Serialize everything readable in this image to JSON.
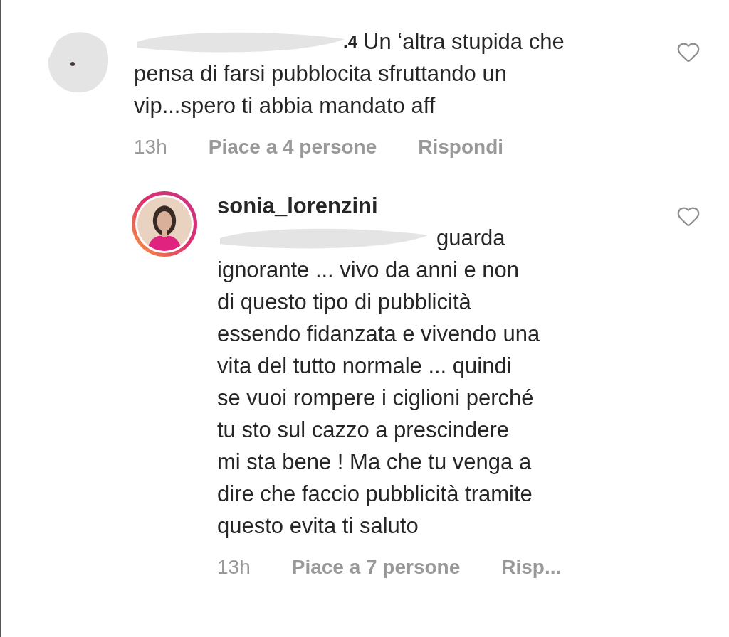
{
  "comments": [
    {
      "kind": "comment",
      "avatar_redacted": true,
      "username": ".4",
      "username_redacted": true,
      "mention_redacted": false,
      "lines": [
        "Un ‘altra stupida che",
        "pensa di farsi pubblocita sfruttando un",
        "vip...spero ti abbia mandato aff"
      ],
      "liked": false,
      "time": "13h",
      "likes": "Piace a 4 persone",
      "reply": "Rispondi"
    },
    {
      "kind": "reply",
      "avatar_redacted": false,
      "username": "sonia_lorenzini",
      "username_redacted": false,
      "mention_redacted": true,
      "lines": [
        "guarda",
        "ignorante ... vivo da anni e non",
        "di questo tipo di pubblicità",
        "essendo fidanzata e vivendo una",
        "vita del tutto normale ... quindi",
        "se vuoi rompere i ciglioni perché",
        "tu sto sul cazzo a prescindere",
        "mi sta bene ! Ma che tu venga a",
        "dire che faccio pubblicità tramite",
        "questo evita ti saluto"
      ],
      "liked": false,
      "time": "13h",
      "likes": "Piace a 7 persone",
      "reply": "Risp..."
    }
  ]
}
